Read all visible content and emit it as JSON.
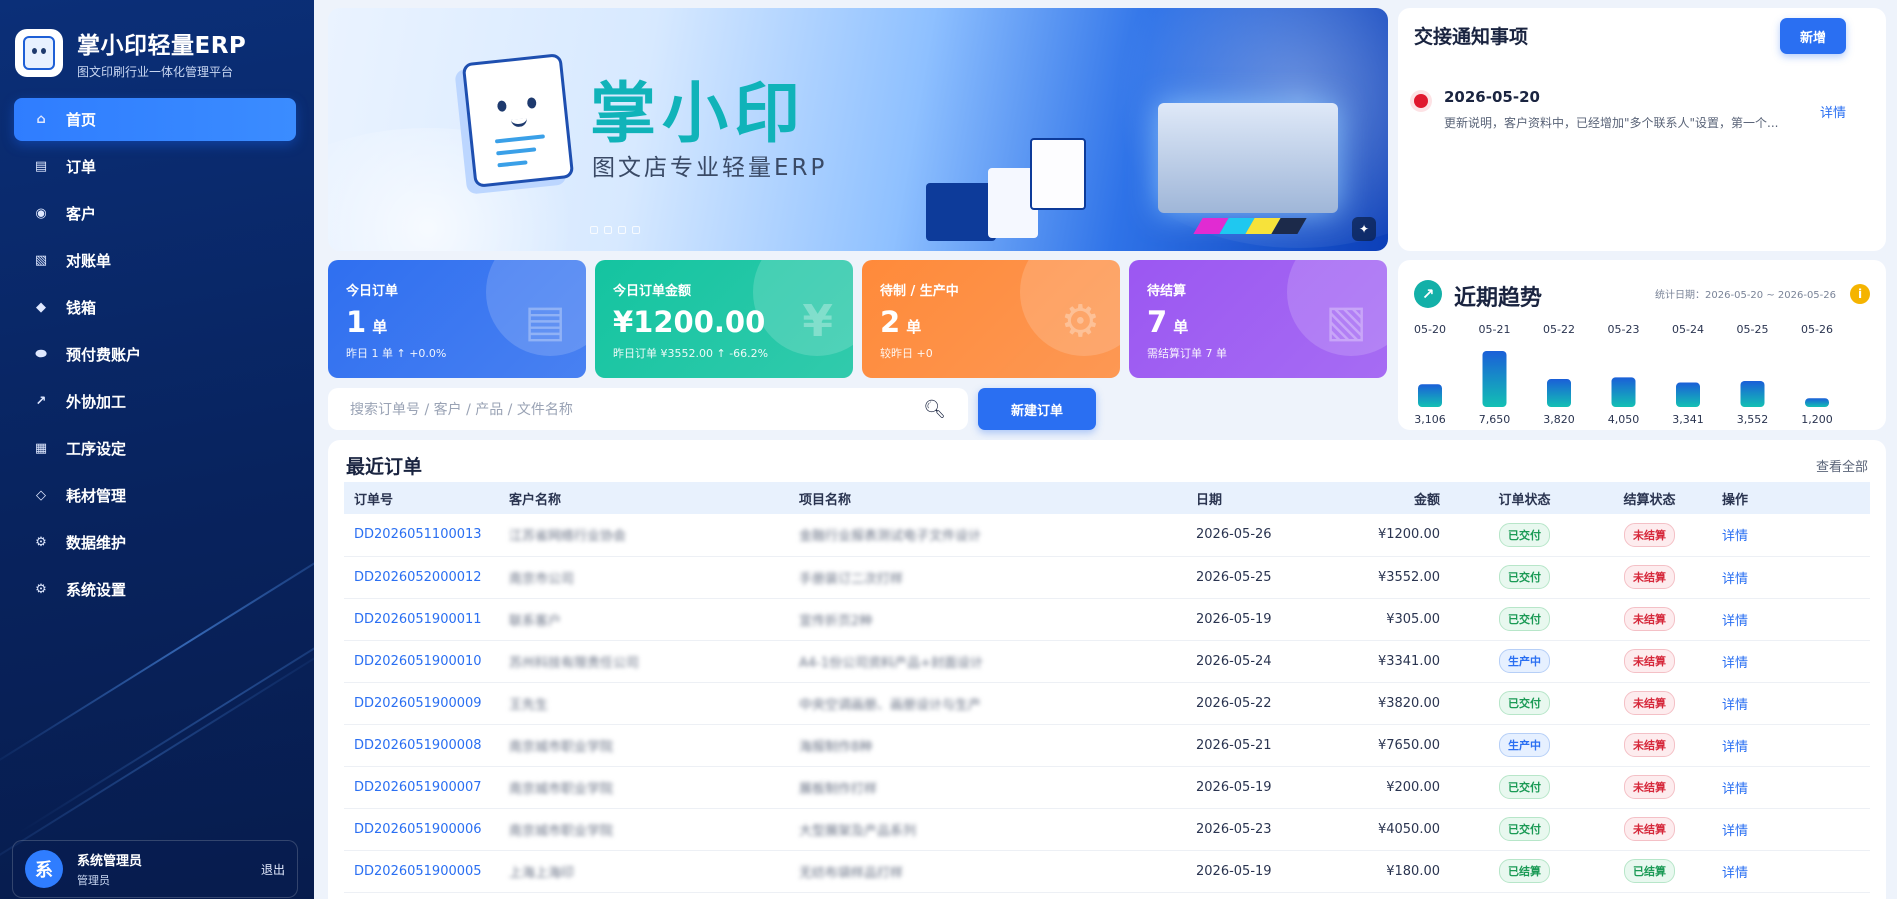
{
  "app": {
    "name": "掌小印轻量ERP",
    "subtitle": "图文印刷行业一体化管理平台"
  },
  "sidebar": {
    "items": [
      {
        "label": "首页",
        "icon": "home-icon",
        "glyph": "⌂",
        "active": true
      },
      {
        "label": "订单",
        "icon": "order-list-icon",
        "glyph": "▤"
      },
      {
        "label": "客户",
        "icon": "customer-icon",
        "glyph": "◉"
      },
      {
        "label": "对账单",
        "icon": "statement-icon",
        "glyph": "▧"
      },
      {
        "label": "钱箱",
        "icon": "cashbox-icon",
        "glyph": "◆"
      },
      {
        "label": "预付费账户",
        "icon": "prepaid-icon",
        "glyph": "⬬"
      },
      {
        "label": "外协加工",
        "icon": "outsource-icon",
        "glyph": "↗"
      },
      {
        "label": "工序设定",
        "icon": "process-icon",
        "glyph": "▦"
      },
      {
        "label": "耗材管理",
        "icon": "material-icon",
        "glyph": "◇"
      },
      {
        "label": "数据维护",
        "icon": "data-gear-icon",
        "glyph": "⚙"
      },
      {
        "label": "系统设置",
        "icon": "settings-gear-icon",
        "glyph": "⚙"
      }
    ]
  },
  "user": {
    "avatar": "系",
    "name": "系统管理员",
    "role": "管理员",
    "logout": "退出"
  },
  "banner": {
    "title": "掌小印",
    "subtitle": "图文店专业轻量ERP"
  },
  "notice": {
    "title": "交接通知事项",
    "add_label": "新增",
    "items": [
      {
        "date": "2026-05-20",
        "text": "更新说明，客户资料中，已经增加\"多个联系人\"设置，第一个...",
        "detail": "详情"
      }
    ]
  },
  "stats": [
    {
      "label": "今日订单",
      "value": "1",
      "unit": "单",
      "sub": "昨日 1 单  ↑ +0.0%",
      "color": "#2f6ff0",
      "glyph": "▤"
    },
    {
      "label": "今日订单金额",
      "value": "¥1200.00",
      "unit": "",
      "sub": "昨日订单 ¥3552.00  ↑ -66.2%",
      "color": "#14c4a0",
      "glyph": "¥"
    },
    {
      "label": "待制 / 生产中",
      "value": "2",
      "unit": "单",
      "sub": "较昨日 +0",
      "color": "#ff8a3a",
      "glyph": "⚙"
    },
    {
      "label": "待结算",
      "value": "7",
      "unit": "单",
      "sub": "需结算订单 7 单",
      "color": "#9b57f2",
      "glyph": "▧"
    }
  ],
  "search": {
    "placeholder": "搜索订单号 / 客户 / 产品 / 文件名称",
    "new_order": "新建订单"
  },
  "trend": {
    "title": "近期趋势",
    "range": "统计日期：2026-05-20 ~ 2026-05-26",
    "info": "i",
    "dates": [
      "05-20",
      "05-21",
      "05-22",
      "05-23",
      "05-24",
      "05-25",
      "05-26"
    ],
    "values": [
      3106,
      7650,
      3820,
      4050,
      3341,
      3552,
      1200
    ],
    "labels": [
      "3,106",
      "7,650",
      "3,820",
      "4,050",
      "3,341",
      "3,552",
      "1,200"
    ]
  },
  "chart_data": {
    "type": "bar",
    "title": "近期趋势",
    "categories": [
      "05-20",
      "05-21",
      "05-22",
      "05-23",
      "05-24",
      "05-25",
      "05-26"
    ],
    "values": [
      3106,
      7650,
      3820,
      4050,
      3341,
      3552,
      1200
    ]
  },
  "orders": {
    "title": "最近订单",
    "view_all": "查看全部",
    "columns": [
      "订单号",
      "客户名称",
      "项目名称",
      "日期",
      "金额",
      "订单状态",
      "结算状态",
      "操作"
    ],
    "rows": [
      {
        "id": "DD2026051100013",
        "customer": "江苏省网络行业协会",
        "project": "金融行业报表测试电子文件设计",
        "date": "2026-05-26",
        "amount": "¥1200.00",
        "status": "已交付",
        "settle": "未结算",
        "op": "详情"
      },
      {
        "id": "DD2026052000012",
        "customer": "南京市公司",
        "project": "手册装订二次打样",
        "date": "2026-05-25",
        "amount": "¥3552.00",
        "status": "已交付",
        "settle": "未结算",
        "op": "详情"
      },
      {
        "id": "DD2026051900011",
        "customer": "联系客户",
        "project": "宣传折页2种",
        "date": "2026-05-19",
        "amount": "¥305.00",
        "status": "已交付",
        "settle": "未结算",
        "op": "详情"
      },
      {
        "id": "DD2026051900010",
        "customer": "苏州科技有限责任公司",
        "project": "A4-1份公司资料产品+封面设计",
        "date": "2026-05-24",
        "amount": "¥3341.00",
        "status": "生产中",
        "settle": "未结算",
        "op": "详情"
      },
      {
        "id": "DD2026051900009",
        "customer": "王先生",
        "project": "中央空调画册、画册设计与生产",
        "date": "2026-05-22",
        "amount": "¥3820.00",
        "status": "已交付",
        "settle": "未结算",
        "op": "详情"
      },
      {
        "id": "DD2026051900008",
        "customer": "南京城市职业学院",
        "project": "海报制作8种",
        "date": "2026-05-21",
        "amount": "¥7650.00",
        "status": "生产中",
        "settle": "未结算",
        "op": "详情"
      },
      {
        "id": "DD2026051900007",
        "customer": "南京城市职业学院",
        "project": "展板制作打样",
        "date": "2026-05-19",
        "amount": "¥200.00",
        "status": "已交付",
        "settle": "未结算",
        "op": "详情"
      },
      {
        "id": "DD2026051900006",
        "customer": "南京城市职业学院",
        "project": "大型展架及产品系列",
        "date": "2026-05-23",
        "amount": "¥4050.00",
        "status": "已交付",
        "settle": "未结算",
        "op": "详情"
      },
      {
        "id": "DD2026051900005",
        "customer": "上海上海印",
        "project": "无纺布袋样品打样",
        "date": "2026-05-19",
        "amount": "¥180.00",
        "status": "已结算",
        "settle": "已结算",
        "op": "详情"
      }
    ]
  },
  "colors": {
    "accent": "#2a6ff2",
    "sidebar": "#08235e",
    "teal": "#13b0a8"
  }
}
